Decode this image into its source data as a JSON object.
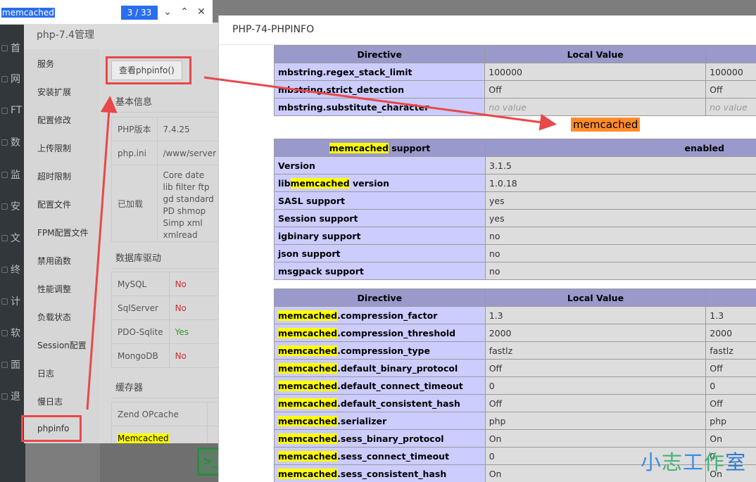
{
  "find_bar": {
    "query": "memcached",
    "count": "3 / 33",
    "prev_icon": "chevron-down-icon",
    "next_icon": "chevron-up-icon",
    "close_icon": "close-icon"
  },
  "bg_nav": [
    "首",
    "网",
    "FT",
    "数",
    "监",
    "安",
    "文",
    "终",
    "计",
    "软",
    "面",
    "退"
  ],
  "php_dialog": {
    "title": "php-7.4管理",
    "sidebar": [
      "服务",
      "安装扩展",
      "配置修改",
      "上传限制",
      "超时限制",
      "配置文件",
      "FPM配置文件",
      "禁用函数",
      "性能调整",
      "负载状态",
      "Session配置",
      "日志",
      "慢日志",
      "phpinfo"
    ],
    "phpinfo_button": "查看phpinfo()",
    "basic_title": "基本信息",
    "basic_rows": [
      {
        "k": "PHP版本",
        "v": "7.4.25"
      },
      {
        "k": "php.ini",
        "v": "/www/server"
      },
      {
        "k": "已加载",
        "v": "Core date lib filter ftp gd standard PD shmop Simp xml xmlread"
      }
    ],
    "db_title": "数据库驱动",
    "db_rows": [
      {
        "k": "MySQL",
        "v": "No"
      },
      {
        "k": "SqlServer",
        "v": "No"
      },
      {
        "k": "PDO-Sqlite",
        "v": "Yes"
      },
      {
        "k": "MongoDB",
        "v": "No"
      }
    ],
    "cache_title": "缓存器",
    "cache_rows": [
      {
        "k": "Zend OPcache"
      },
      {
        "k": "Memcached"
      }
    ]
  },
  "info_window": {
    "title": "PHP-74-PHPINFO",
    "mbstring": {
      "headers": [
        "Directive",
        "Local Value",
        ""
      ],
      "rows": [
        {
          "d": "mbstring.regex_stack_limit",
          "l": "100000",
          "m": "100000"
        },
        {
          "d": "mbstring.strict_detection",
          "l": "Off",
          "m": "Off"
        },
        {
          "d": "mbstring.substitute_character",
          "l": "no value",
          "m": "no value"
        }
      ]
    },
    "section_heading": "memcached",
    "support": {
      "header_hl": "memcached",
      "header_rest": " support",
      "header_val": "enabled",
      "rows": [
        {
          "k": "Version",
          "v": "3.1.5"
        },
        {
          "k_pre": "lib",
          "k_hl": "memcached",
          "k_post": " version",
          "v": "1.0.18"
        },
        {
          "k": "SASL support",
          "v": "yes"
        },
        {
          "k": "Session support",
          "v": "yes"
        },
        {
          "k": "igbinary support",
          "v": "no"
        },
        {
          "k": "json support",
          "v": "no"
        },
        {
          "k": "msgpack support",
          "v": "no"
        }
      ]
    },
    "directives": {
      "headers": [
        "Directive",
        "Local Value",
        ""
      ],
      "prefix": "memcached",
      "rows": [
        {
          "s": ".compression_factor",
          "l": "1.3",
          "m": "1.3"
        },
        {
          "s": ".compression_threshold",
          "l": "2000",
          "m": "2000"
        },
        {
          "s": ".compression_type",
          "l": "fastlz",
          "m": "fastlz"
        },
        {
          "s": ".default_binary_protocol",
          "l": "Off",
          "m": "Off"
        },
        {
          "s": ".default_connect_timeout",
          "l": "0",
          "m": "0"
        },
        {
          "s": ".default_consistent_hash",
          "l": "Off",
          "m": "Off"
        },
        {
          "s": ".serializer",
          "l": "php",
          "m": "php"
        },
        {
          "s": ".sess_binary_protocol",
          "l": "On",
          "m": "On"
        },
        {
          "s": ".sess_connect_timeout",
          "l": "0",
          "m": "0"
        },
        {
          "s": ".sess_consistent_hash",
          "l": "On",
          "m": "On"
        }
      ]
    }
  },
  "watermark": {
    "c1": "小",
    "c2": "志",
    "c3": "工",
    "c4": "作",
    "c5": "室"
  },
  "colors": {
    "annotation_red": "#e8484a",
    "highlight": "#ffff00",
    "heading_orange": "#ff8c2a",
    "header_purple": "#9999cc",
    "key_lavender": "#ccccff"
  }
}
